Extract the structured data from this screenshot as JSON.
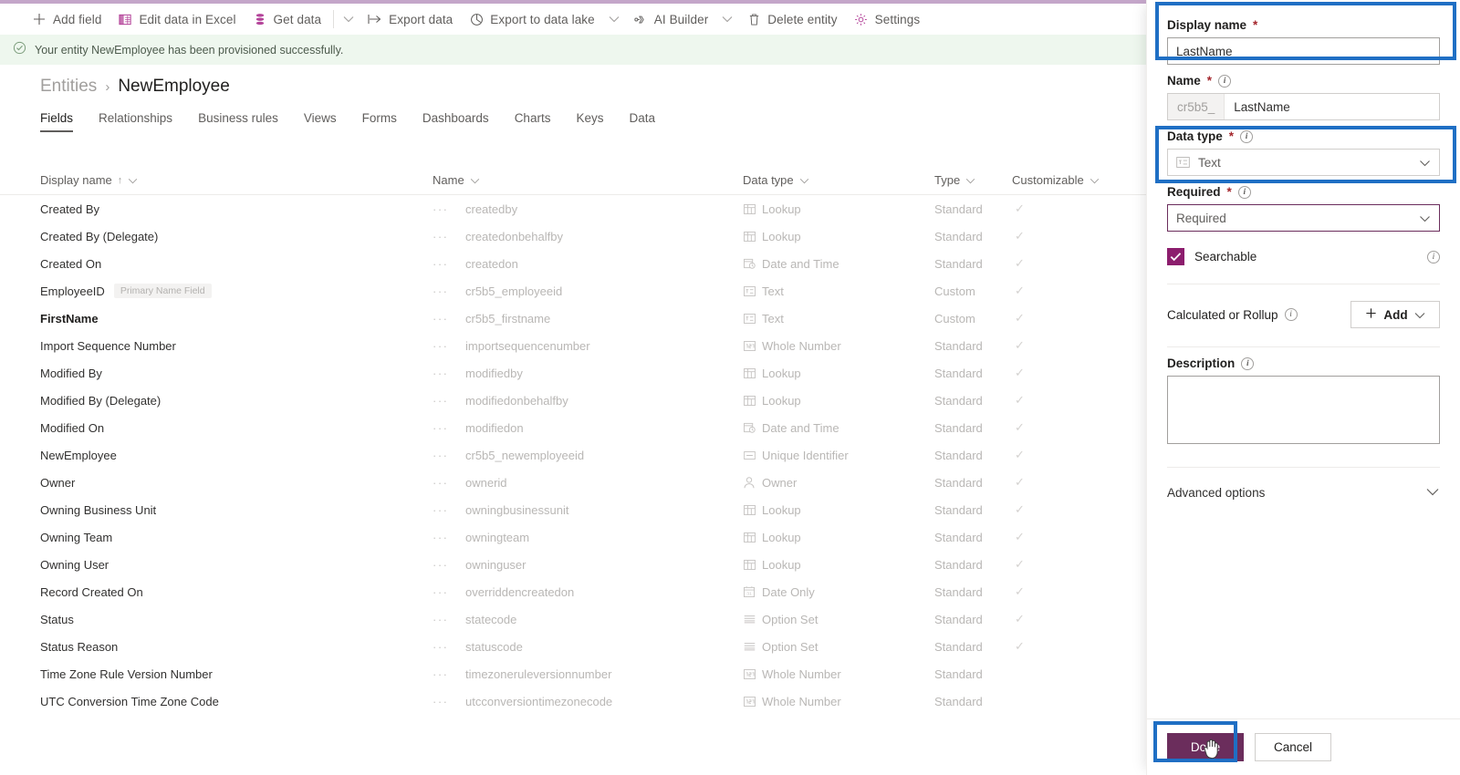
{
  "commandbar": {
    "items": [
      {
        "label": "Add field",
        "icon": "plus-icon",
        "chevron": false
      },
      {
        "label": "Edit data in Excel",
        "icon": "excel-icon",
        "chevron": false
      },
      {
        "label": "Get data",
        "icon": "database-icon",
        "chevron": false
      },
      {
        "label": "",
        "icon": "chevron-down-icon",
        "chevron": true
      },
      {
        "label": "Export data",
        "icon": "export-icon",
        "chevron": false
      },
      {
        "label": "Export to data lake",
        "icon": "datalake-icon",
        "chevron": true
      },
      {
        "label": "AI Builder",
        "icon": "ai-builder-icon",
        "chevron": true
      },
      {
        "label": "Delete entity",
        "icon": "trash-icon",
        "chevron": false
      },
      {
        "label": "Settings",
        "icon": "gear-icon",
        "chevron": false
      }
    ]
  },
  "banner": {
    "icon": "check-circle-icon",
    "message": "Your entity NewEmployee has been provisioned successfully."
  },
  "breadcrumb": {
    "parent": "Entities",
    "separator": "›",
    "current": "NewEmployee"
  },
  "tabs": [
    {
      "label": "Fields",
      "active": true
    },
    {
      "label": "Relationships",
      "active": false
    },
    {
      "label": "Business rules",
      "active": false
    },
    {
      "label": "Views",
      "active": false
    },
    {
      "label": "Forms",
      "active": false
    },
    {
      "label": "Dashboards",
      "active": false
    },
    {
      "label": "Charts",
      "active": false
    },
    {
      "label": "Keys",
      "active": false
    },
    {
      "label": "Data",
      "active": false
    }
  ],
  "table": {
    "columns": [
      {
        "label": "Display name",
        "sorted": true,
        "sort_arrow": "↑"
      },
      {
        "label": "Name",
        "sorted": false
      },
      {
        "label": "Data type",
        "sorted": false
      },
      {
        "label": "Type",
        "sorted": false
      },
      {
        "label": "Customizable",
        "sorted": false
      }
    ],
    "rows": [
      {
        "display": "Created By",
        "badge": "",
        "bold": false,
        "name": "createdby",
        "dtype": "Lookup",
        "dicon": "lookup-icon",
        "type": "Standard",
        "customizable": true
      },
      {
        "display": "Created By (Delegate)",
        "badge": "",
        "bold": false,
        "name": "createdonbehalfby",
        "dtype": "Lookup",
        "dicon": "lookup-icon",
        "type": "Standard",
        "customizable": true
      },
      {
        "display": "Created On",
        "badge": "",
        "bold": false,
        "name": "createdon",
        "dtype": "Date and Time",
        "dicon": "datetime-icon",
        "type": "Standard",
        "customizable": true
      },
      {
        "display": "EmployeeID",
        "badge": "Primary Name Field",
        "bold": false,
        "name": "cr5b5_employeeid",
        "dtype": "Text",
        "dicon": "text-icon",
        "type": "Custom",
        "customizable": true
      },
      {
        "display": "FirstName",
        "badge": "",
        "bold": true,
        "name": "cr5b5_firstname",
        "dtype": "Text",
        "dicon": "text-icon",
        "type": "Custom",
        "customizable": true
      },
      {
        "display": "Import Sequence Number",
        "badge": "",
        "bold": false,
        "name": "importsequencenumber",
        "dtype": "Whole Number",
        "dicon": "number-icon",
        "type": "Standard",
        "customizable": true
      },
      {
        "display": "Modified By",
        "badge": "",
        "bold": false,
        "name": "modifiedby",
        "dtype": "Lookup",
        "dicon": "lookup-icon",
        "type": "Standard",
        "customizable": true
      },
      {
        "display": "Modified By (Delegate)",
        "badge": "",
        "bold": false,
        "name": "modifiedonbehalfby",
        "dtype": "Lookup",
        "dicon": "lookup-icon",
        "type": "Standard",
        "customizable": true
      },
      {
        "display": "Modified On",
        "badge": "",
        "bold": false,
        "name": "modifiedon",
        "dtype": "Date and Time",
        "dicon": "datetime-icon",
        "type": "Standard",
        "customizable": true
      },
      {
        "display": "NewEmployee",
        "badge": "",
        "bold": false,
        "name": "cr5b5_newemployeeid",
        "dtype": "Unique Identifier",
        "dicon": "uid-icon",
        "type": "Standard",
        "customizable": true
      },
      {
        "display": "Owner",
        "badge": "",
        "bold": false,
        "name": "ownerid",
        "dtype": "Owner",
        "dicon": "person-icon",
        "type": "Standard",
        "customizable": true
      },
      {
        "display": "Owning Business Unit",
        "badge": "",
        "bold": false,
        "name": "owningbusinessunit",
        "dtype": "Lookup",
        "dicon": "lookup-icon",
        "type": "Standard",
        "customizable": true
      },
      {
        "display": "Owning Team",
        "badge": "",
        "bold": false,
        "name": "owningteam",
        "dtype": "Lookup",
        "dicon": "lookup-icon",
        "type": "Standard",
        "customizable": true
      },
      {
        "display": "Owning User",
        "badge": "",
        "bold": false,
        "name": "owninguser",
        "dtype": "Lookup",
        "dicon": "lookup-icon",
        "type": "Standard",
        "customizable": true
      },
      {
        "display": "Record Created On",
        "badge": "",
        "bold": false,
        "name": "overriddencreatedon",
        "dtype": "Date Only",
        "dicon": "dateonly-icon",
        "type": "Standard",
        "customizable": true
      },
      {
        "display": "Status",
        "badge": "",
        "bold": false,
        "name": "statecode",
        "dtype": "Option Set",
        "dicon": "optionset-icon",
        "type": "Standard",
        "customizable": true
      },
      {
        "display": "Status Reason",
        "badge": "",
        "bold": false,
        "name": "statuscode",
        "dtype": "Option Set",
        "dicon": "optionset-icon",
        "type": "Standard",
        "customizable": true
      },
      {
        "display": "Time Zone Rule Version Number",
        "badge": "",
        "bold": false,
        "name": "timezoneruleversionnumber",
        "dtype": "Whole Number",
        "dicon": "number-icon",
        "type": "Standard",
        "customizable": false
      },
      {
        "display": "UTC Conversion Time Zone Code",
        "badge": "",
        "bold": false,
        "name": "utcconversiontimezonecode",
        "dtype": "Whole Number",
        "dicon": "number-icon",
        "type": "Standard",
        "customizable": false
      }
    ],
    "checkmark": "✓",
    "row_menu": "···"
  },
  "panel": {
    "display_name": {
      "label": "Display name",
      "required_mark": "*",
      "value": "LastName"
    },
    "name": {
      "label": "Name",
      "required_mark": "*",
      "prefix": "cr5b5_",
      "value": "LastName",
      "info": "info-icon"
    },
    "data_type": {
      "label": "Data type",
      "required_mark": "*",
      "value": "Text",
      "icon": "text-icon",
      "info": "info-icon"
    },
    "required": {
      "label": "Required",
      "required_mark": "*",
      "value": "Required",
      "info": "info-icon"
    },
    "searchable": {
      "label": "Searchable",
      "checked": true,
      "info": "info-icon"
    },
    "rollup": {
      "label": "Calculated or Rollup",
      "add_label": "Add",
      "info": "info-icon"
    },
    "description": {
      "label": "Description",
      "value": "",
      "info": "info-icon"
    },
    "advanced": {
      "label": "Advanced options"
    },
    "footer": {
      "done_label": "Done",
      "cancel_label": "Cancel"
    }
  },
  "colors": {
    "brand_purple": "#6b2d5c",
    "checkbox_purple": "#8c1d6d",
    "annotation_blue": "#1f6fc4",
    "banner_green": "#eef7ee",
    "topstrip": "#c4a6c9"
  }
}
